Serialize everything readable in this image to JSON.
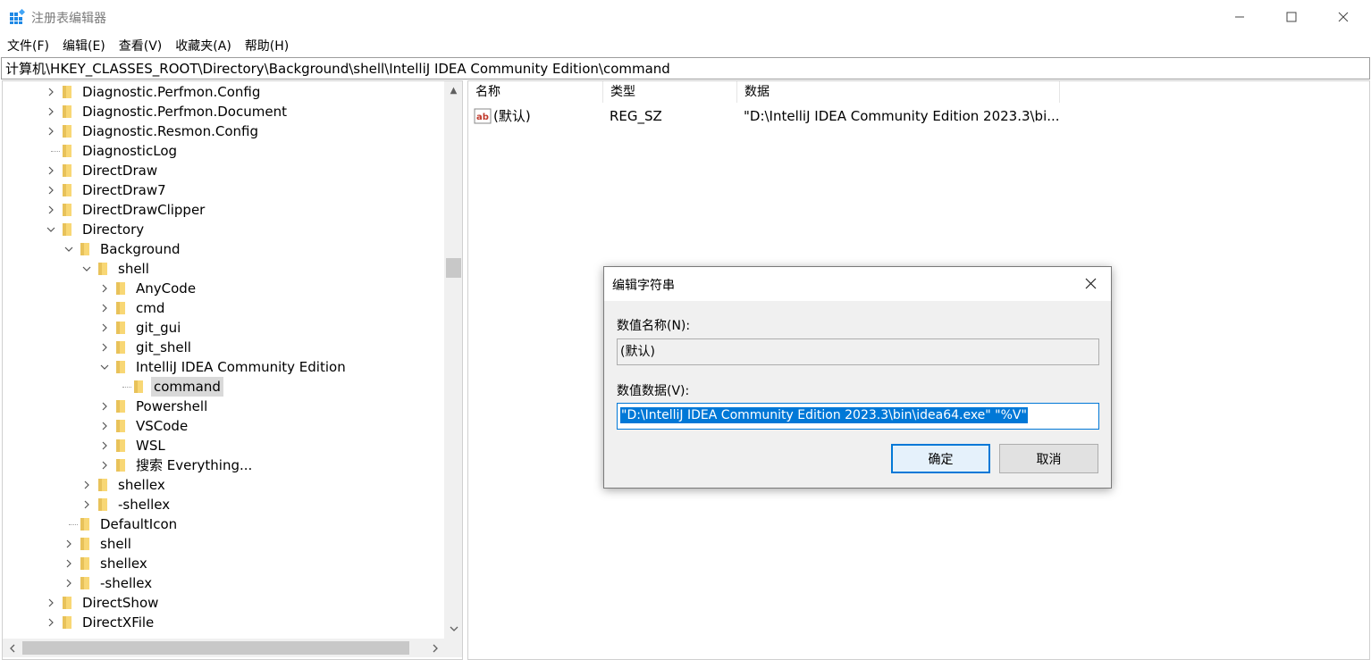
{
  "window": {
    "title": "注册表编辑器",
    "icon": "registry-editor-icon"
  },
  "menu": [
    "文件(F)",
    "编辑(E)",
    "查看(V)",
    "收藏夹(A)",
    "帮助(H)"
  ],
  "address": "计算机\\HKEY_CLASSES_ROOT\\Directory\\Background\\shell\\IntelliJ IDEA Community Edition\\command",
  "tree": [
    {
      "label": "Diagnostic.Perfmon.Config",
      "expander": "collapsed"
    },
    {
      "label": "Diagnostic.Perfmon.Document",
      "expander": "collapsed"
    },
    {
      "label": "Diagnostic.Resmon.Config",
      "expander": "collapsed"
    },
    {
      "label": "DiagnosticLog",
      "expander": "none"
    },
    {
      "label": "DirectDraw",
      "expander": "collapsed"
    },
    {
      "label": "DirectDraw7",
      "expander": "collapsed"
    },
    {
      "label": "DirectDrawClipper",
      "expander": "collapsed"
    },
    {
      "label": "Directory",
      "expander": "expanded"
    },
    {
      "label": "Background",
      "expander": "expanded"
    },
    {
      "label": "shell",
      "expander": "expanded"
    },
    {
      "label": "AnyCode",
      "expander": "collapsed"
    },
    {
      "label": "cmd",
      "expander": "collapsed"
    },
    {
      "label": "git_gui",
      "expander": "collapsed"
    },
    {
      "label": "git_shell",
      "expander": "collapsed"
    },
    {
      "label": "IntelliJ IDEA Community Edition",
      "expander": "expanded"
    },
    {
      "label": "command",
      "expander": "none",
      "selected": true
    },
    {
      "label": "Powershell",
      "expander": "collapsed"
    },
    {
      "label": "VSCode",
      "expander": "collapsed"
    },
    {
      "label": "WSL",
      "expander": "collapsed"
    },
    {
      "label": "搜索 Everything...",
      "expander": "collapsed"
    },
    {
      "label": "shellex",
      "expander": "collapsed"
    },
    {
      "label": "-shellex",
      "expander": "collapsed"
    },
    {
      "label": "DefaultIcon",
      "expander": "none"
    },
    {
      "label": "shell",
      "expander": "collapsed"
    },
    {
      "label": "shellex",
      "expander": "collapsed"
    },
    {
      "label": "-shellex",
      "expander": "collapsed"
    },
    {
      "label": "DirectShow",
      "expander": "collapsed"
    },
    {
      "label": "DirectXFile",
      "expander": "collapsed"
    }
  ],
  "list": {
    "headers": [
      "名称",
      "类型",
      "数据"
    ],
    "rows": [
      {
        "icon": "string-value-icon",
        "name": "(默认)",
        "type": "REG_SZ",
        "data": "\"D:\\IntelliJ IDEA Community Edition 2023.3\\bi..."
      }
    ]
  },
  "dialog": {
    "title": "编辑字符串",
    "name_label": "数值名称(N):",
    "name_value": "(默认)",
    "data_label": "数值数据(V):",
    "data_value": "\"D:\\IntelliJ IDEA Community Edition 2023.3\\bin\\idea64.exe\" \"%V\"",
    "ok_label": "确定",
    "cancel_label": "取消"
  },
  "colors": {
    "accent": "#0078d7",
    "folder": "#f8d775"
  }
}
